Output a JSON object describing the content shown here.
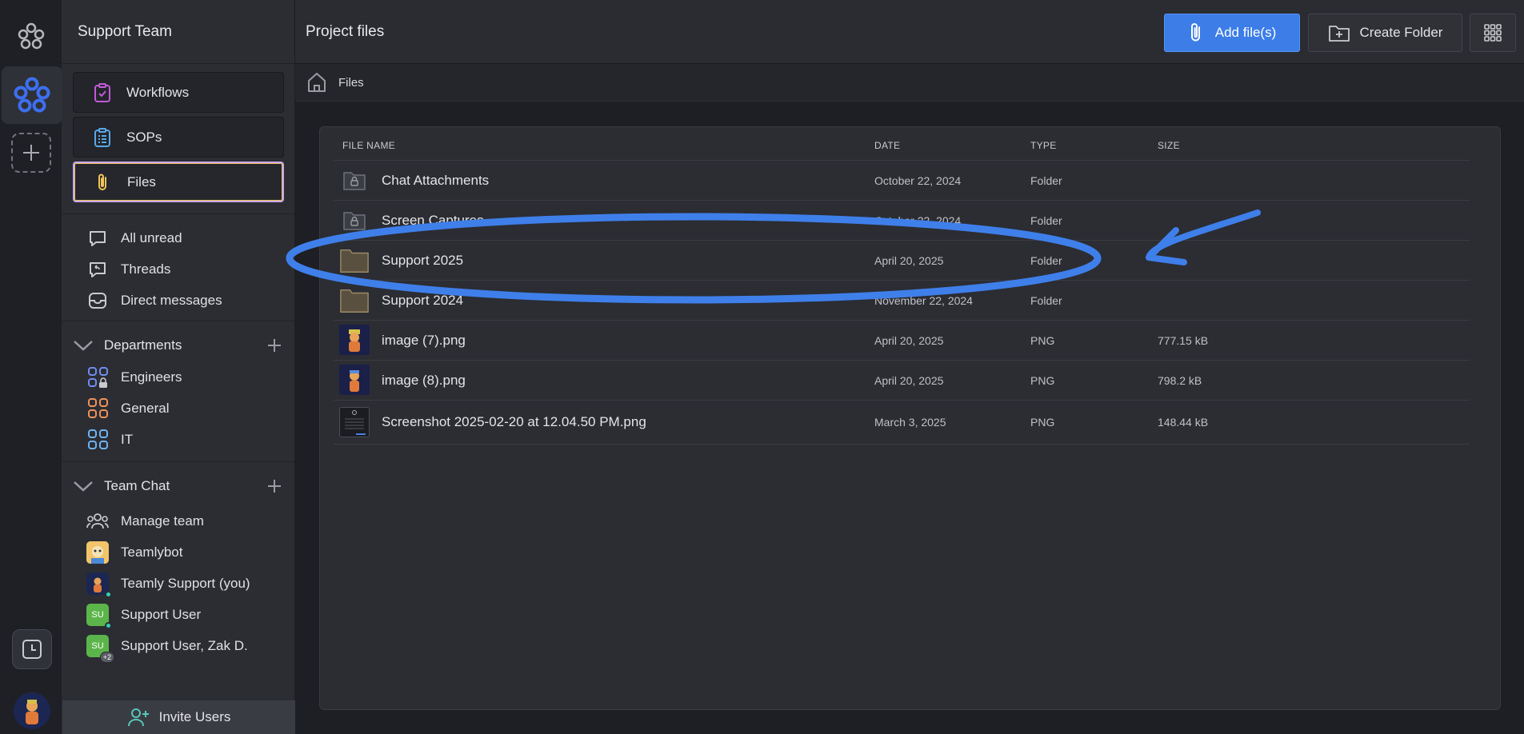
{
  "sidebar": {
    "team_name": "Support Team",
    "nav": [
      {
        "label": "Workflows",
        "icon": "clipboard-check-icon"
      },
      {
        "label": "SOPs",
        "icon": "clipboard-list-icon"
      },
      {
        "label": "Files",
        "icon": "paperclip-icon",
        "active": true
      }
    ],
    "inbox": [
      {
        "label": "All unread",
        "icon": "chat-bubble-icon"
      },
      {
        "label": "Threads",
        "icon": "threads-icon"
      },
      {
        "label": "Direct messages",
        "icon": "inbox-icon"
      }
    ],
    "departments": {
      "title": "Departments",
      "items": [
        {
          "label": "Engineers",
          "color": "#6f8df0",
          "locked": true
        },
        {
          "label": "General",
          "color": "#f0915a"
        },
        {
          "label": "IT",
          "color": "#6fb3f0"
        }
      ]
    },
    "team_chat": {
      "title": "Team Chat",
      "items": [
        {
          "label": "Manage team",
          "icon": "users-icon"
        },
        {
          "label": "Teamlybot",
          "icon": "bot-avatar"
        },
        {
          "label": "Teamly Support (you)",
          "icon": "support-avatar"
        },
        {
          "label": "Support User",
          "initials": "SU"
        },
        {
          "label": "Support User, Zak D.",
          "initials": "SU",
          "extra": "+2"
        }
      ]
    },
    "invite_label": "Invite Users"
  },
  "main": {
    "title": "Project files",
    "add_files_label": "Add file(s)",
    "create_folder_label": "Create Folder",
    "breadcrumb": "Files",
    "columns": {
      "name": "FILE NAME",
      "date": "DATE",
      "type": "TYPE",
      "size": "SIZE"
    },
    "files": [
      {
        "name": "Chat Attachments",
        "date": "October 22, 2024",
        "type": "Folder",
        "size": "",
        "kind": "locked-folder"
      },
      {
        "name": "Screen Captures",
        "date": "October 22, 2024",
        "type": "Folder",
        "size": "",
        "kind": "locked-folder"
      },
      {
        "name": "Support 2025",
        "date": "April 20, 2025",
        "type": "Folder",
        "size": "",
        "kind": "folder"
      },
      {
        "name": "Support 2024",
        "date": "November 22, 2024",
        "type": "Folder",
        "size": "",
        "kind": "folder"
      },
      {
        "name": "image (7).png",
        "date": "April 20, 2025",
        "type": "PNG",
        "size": "777.15 kB",
        "kind": "image"
      },
      {
        "name": "image (8).png",
        "date": "April 20, 2025",
        "type": "PNG",
        "size": "798.2 kB",
        "kind": "image"
      },
      {
        "name": "Screenshot 2025-02-20 at 12.04.50 PM.png",
        "date": "March 3, 2025",
        "type": "PNG",
        "size": "148.44 kB",
        "kind": "screenshot"
      }
    ]
  },
  "colors": {
    "accent": "#3c7de8",
    "annotation": "#3f7fea",
    "active_border": "#c7a8ef"
  }
}
